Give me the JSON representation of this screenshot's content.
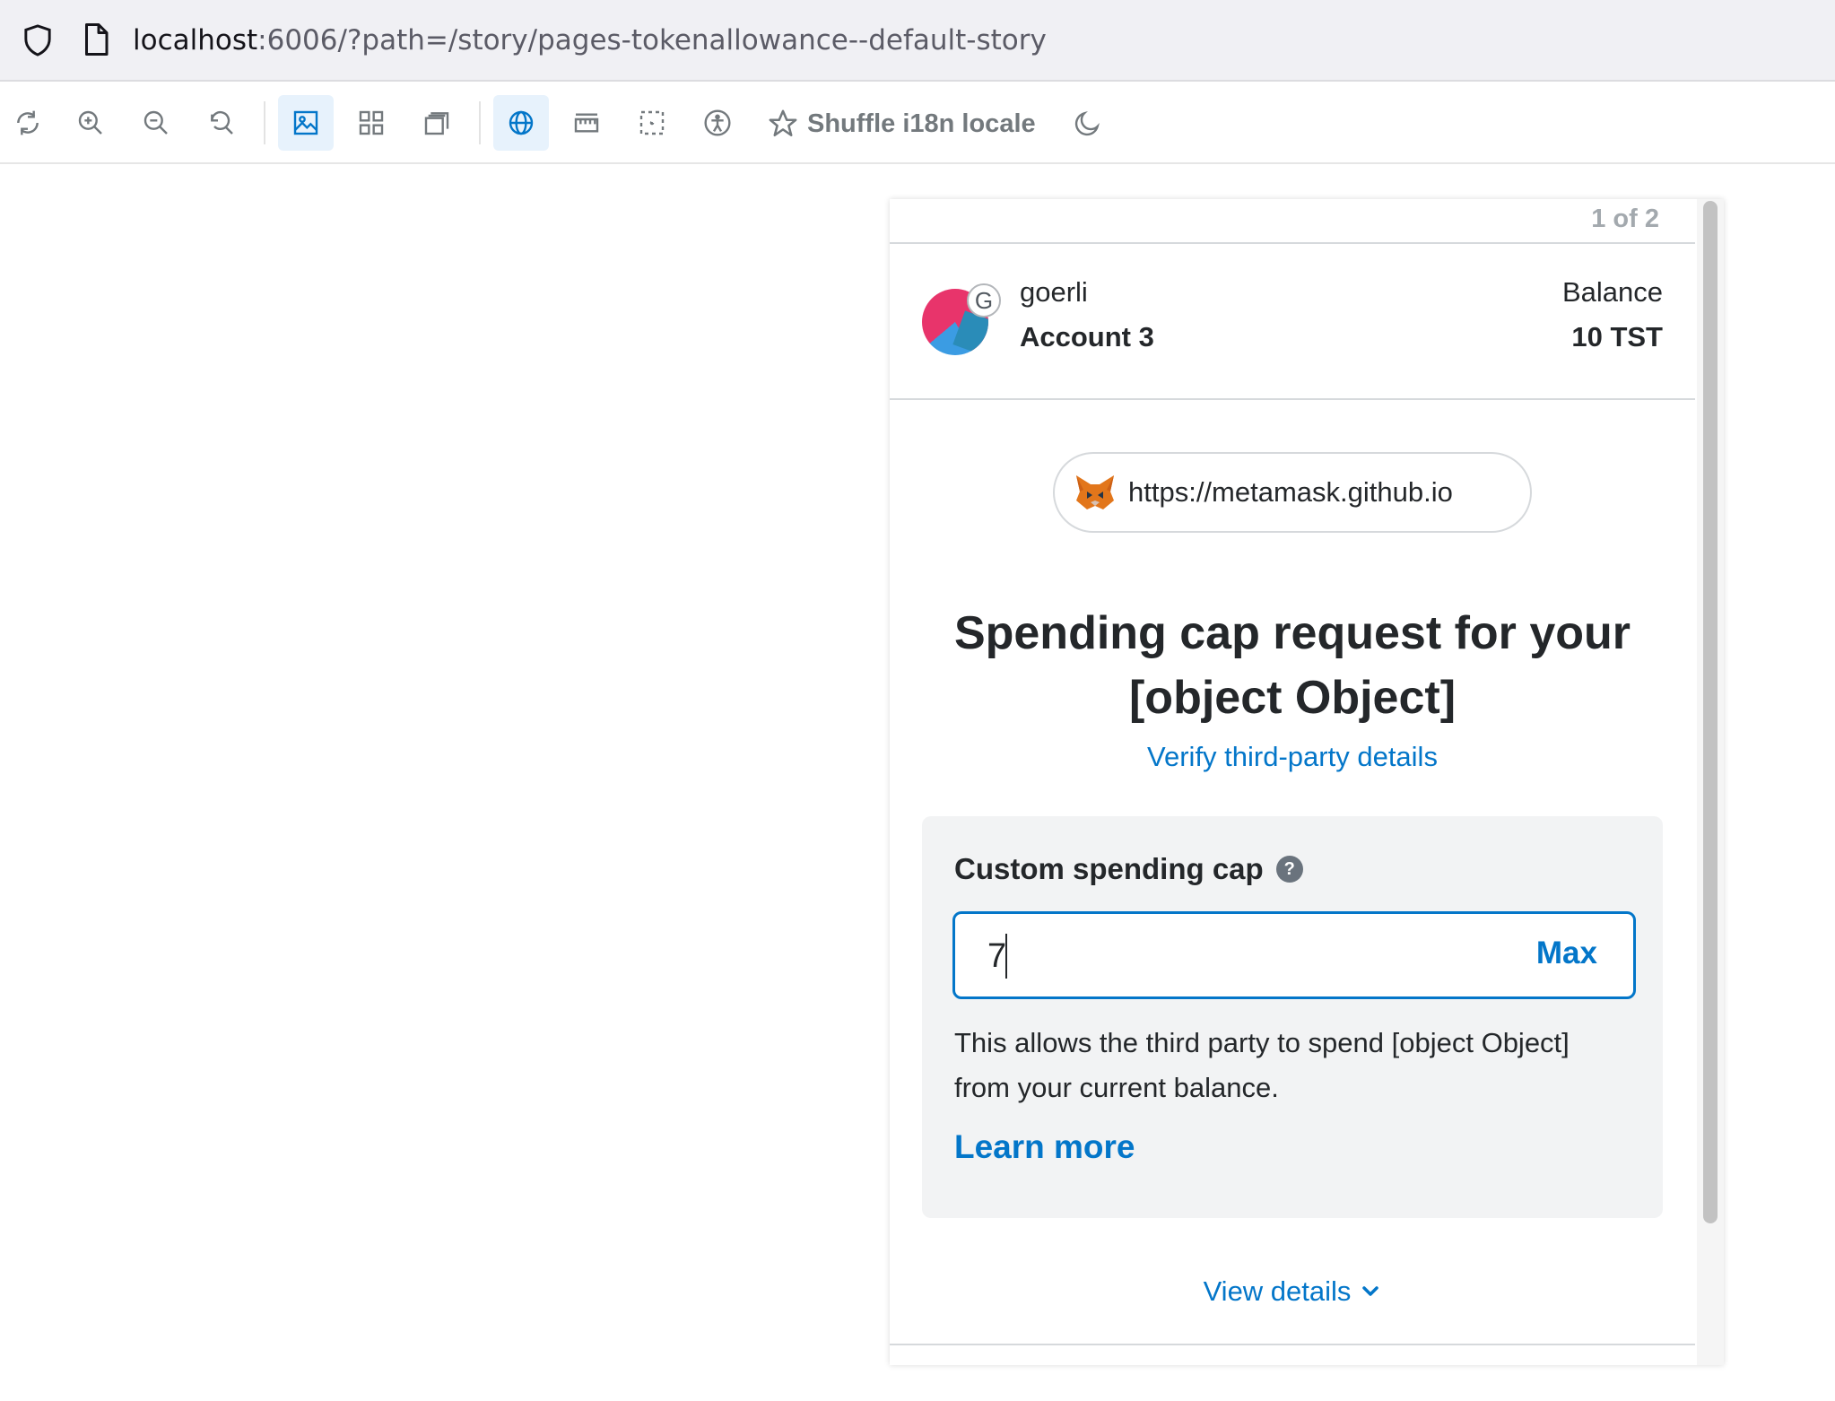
{
  "browser": {
    "url_host": "localhost",
    "url_rest": ":6006/?path=/story/pages-tokenallowance--default-story"
  },
  "toolbar": {
    "shuffle_label": "Shuffle i18n locale",
    "accent_color": "#0376c9"
  },
  "confirmation": {
    "page_indicator": "1 of 2",
    "network_initial": "G",
    "network_name": "goerli",
    "account_name": "Account 3",
    "balance_label": "Balance",
    "balance_value": "10 TST",
    "origin": "https://metamask.github.io",
    "title": "Spending cap request for your [object Object]",
    "verify_link": "Verify third-party details",
    "custom_cap_label": "Custom spending cap",
    "help_glyph": "?",
    "cap_value": "7",
    "max_label": "Max",
    "cap_description": "This allows the third party to spend [object Object] from your current balance.",
    "learn_more": "Learn more",
    "view_details": "View details"
  }
}
